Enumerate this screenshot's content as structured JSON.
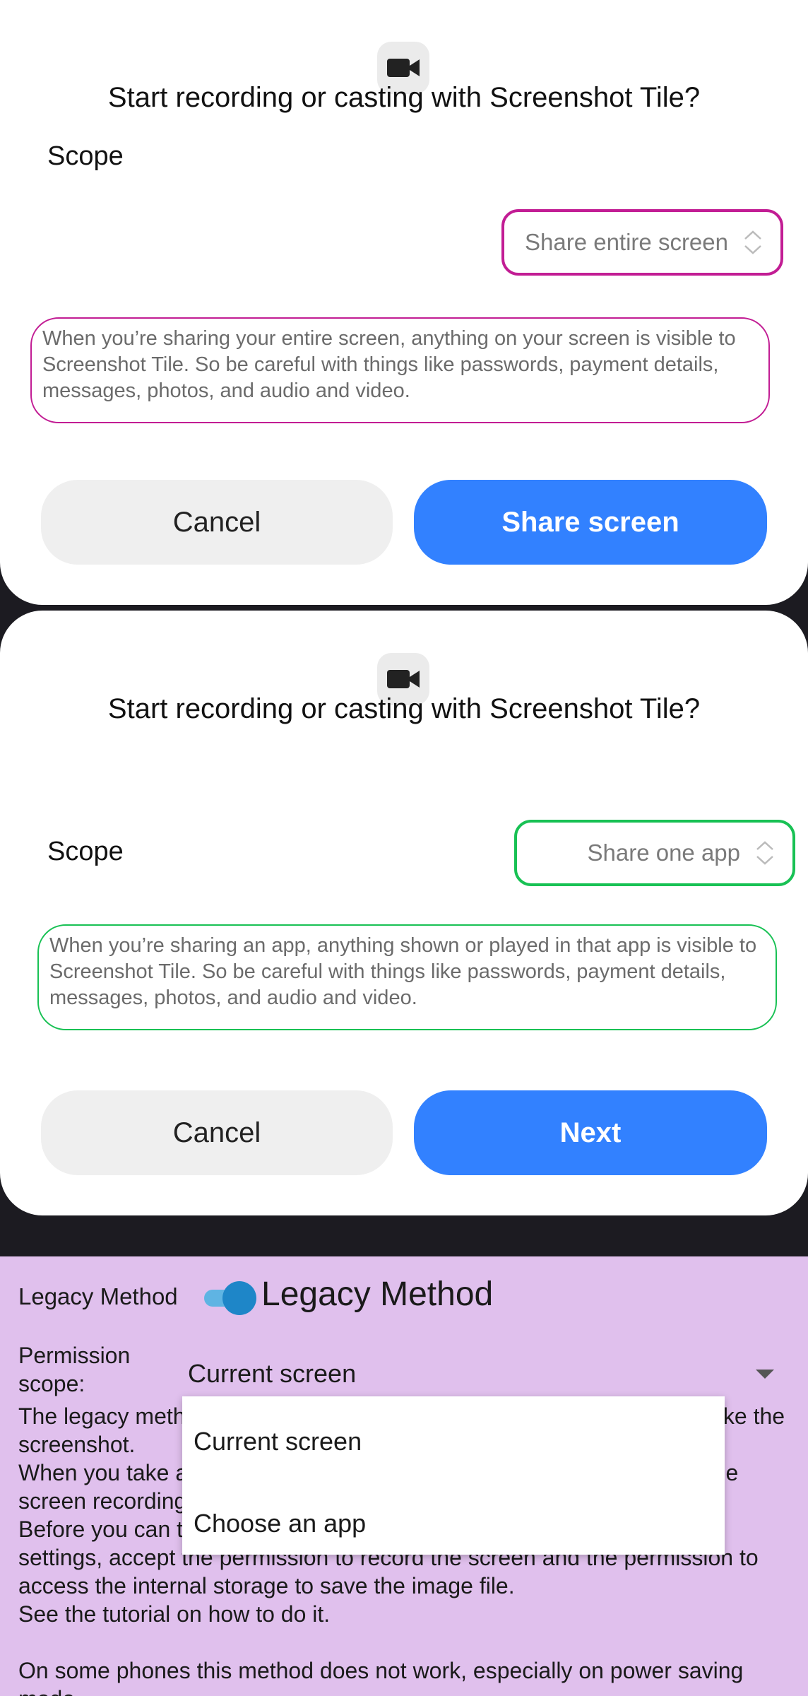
{
  "dialog_entire": {
    "title": "Start recording or casting with Screenshot Tile?",
    "scope_label": "Scope",
    "scope_value": "Share entire screen",
    "warning": "When you’re sharing your entire screen, anything on your screen is visible to Screenshot Tile. So be careful with things like passwords, payment details, messages, photos, and audio and video.",
    "cancel_label": "Cancel",
    "confirm_label": "Share screen",
    "highlight_color": "#c21d94",
    "icon": "video-camera-icon"
  },
  "dialog_app": {
    "title": "Start recording or casting with Screenshot Tile?",
    "scope_label": "Scope",
    "scope_value": "Share one app",
    "warning": "When you’re sharing an app, anything shown or played in that app is visible to Screenshot Tile. So be careful with things like passwords, payment details, messages, photos, and audio and video.",
    "cancel_label": "Cancel",
    "confirm_label": "Next",
    "highlight_color": "#18c154",
    "icon": "video-camera-icon"
  },
  "legacy": {
    "toggle_label": "Legacy Method",
    "toggle_on": true,
    "heading": "Legacy Method",
    "permission_label": "Permission scope:",
    "permission_value": "Current screen",
    "paragraphs": [
      "The legacy method uses the screen recording features of Android to take the screenshot.",
      "When you take a screenshot the permission dialog is shown to open the screen recording. This can be disabled in the app settings.",
      "Before you can take a screenshot you need to add the tile to the quick settings, accept the permission to record the screen and the permission to access the internal storage to save the image file.",
      "See the tutorial on how to do it."
    ],
    "paragraph_after_gap": "On some phones this method does not work, especially on power saving mode."
  },
  "dropdown": {
    "options": [
      "Current screen",
      "Choose an app"
    ]
  },
  "colors": {
    "primary_button": "#3281ff",
    "panel_background": "#e0c0ed",
    "switch_accent": "#1e86c8"
  }
}
